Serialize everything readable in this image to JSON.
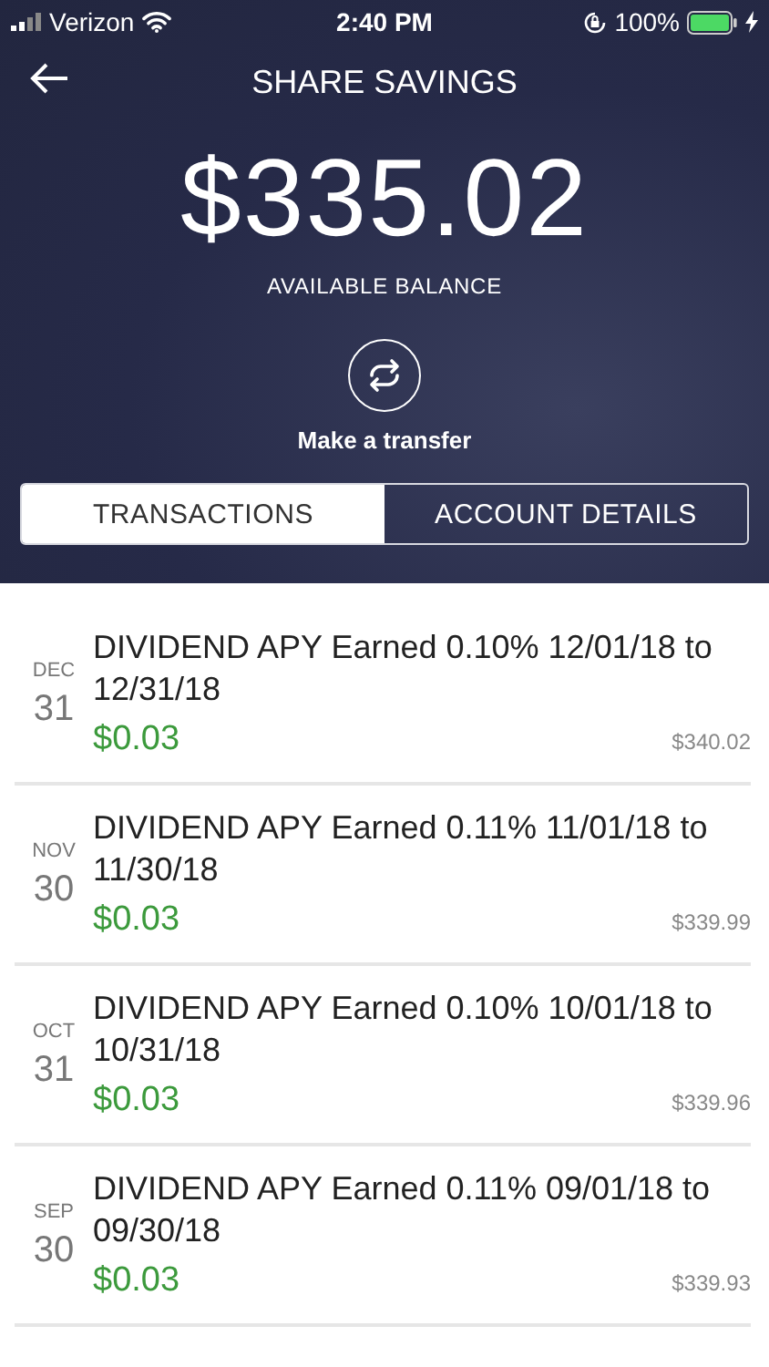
{
  "status_bar": {
    "carrier": "Verizon",
    "time": "2:40 PM",
    "battery": "100%"
  },
  "header": {
    "title": "SHARE SAVINGS",
    "balance": "$335.02",
    "balance_label": "AVAILABLE BALANCE",
    "transfer_label": "Make a transfer"
  },
  "tabs": [
    {
      "label": "TRANSACTIONS",
      "selected": true
    },
    {
      "label": "ACCOUNT DETAILS",
      "selected": false
    }
  ],
  "transactions": [
    {
      "month": "DEC",
      "day": "31",
      "description": "DIVIDEND APY Earned  0.10% 12/01/18 to 12/31/18",
      "amount": "$0.03",
      "balance": "$340.02"
    },
    {
      "month": "NOV",
      "day": "30",
      "description": "DIVIDEND APY Earned  0.11% 11/01/18 to 11/30/18",
      "amount": "$0.03",
      "balance": "$339.99"
    },
    {
      "month": "OCT",
      "day": "31",
      "description": "DIVIDEND APY Earned  0.10% 10/01/18 to 10/31/18",
      "amount": "$0.03",
      "balance": "$339.96"
    },
    {
      "month": "SEP",
      "day": "30",
      "description": "DIVIDEND APY Earned  0.11% 09/01/18 to 09/30/18",
      "amount": "$0.03",
      "balance": "$339.93"
    }
  ]
}
